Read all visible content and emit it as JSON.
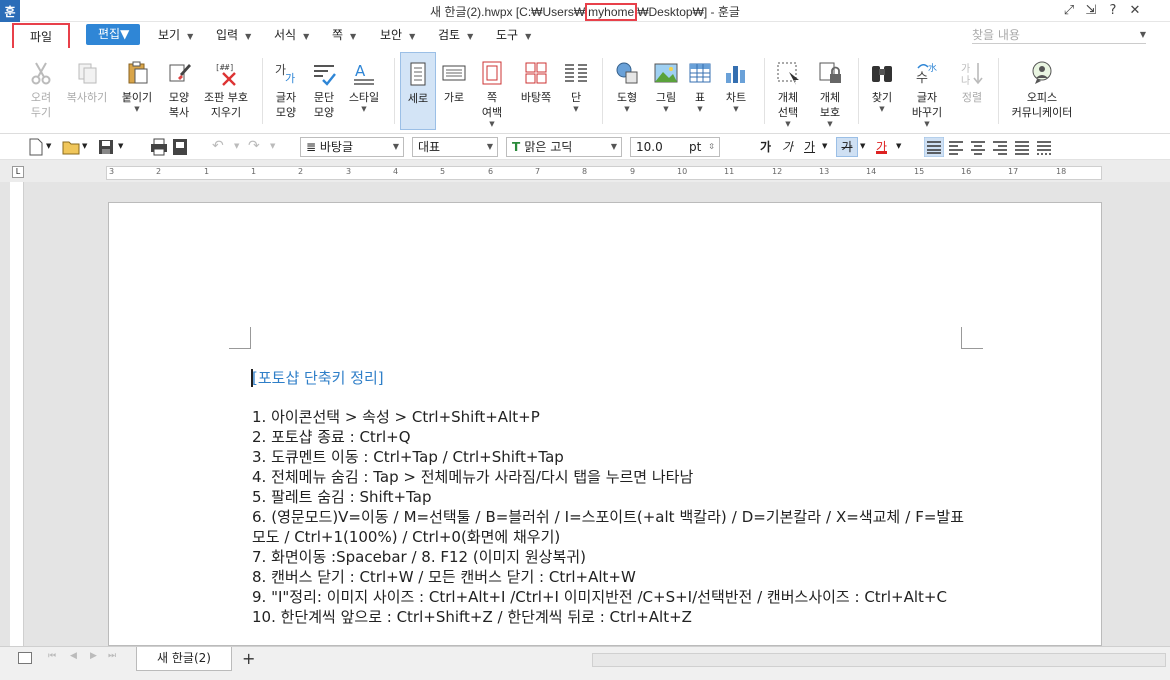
{
  "window": {
    "app_icon": "훈",
    "title_prefix": "새 한글(2).hwpx [C:₩Users₩",
    "title_user": "myhome",
    "title_suffix": "₩Desktop₩] - 훈글",
    "controls": {
      "fullscreen": "⤢",
      "minimize": "⇲",
      "help": "?",
      "close": "✕"
    }
  },
  "menubar": {
    "file": "파일",
    "edit": "편집",
    "items": [
      "보기",
      "입력",
      "서식",
      "쪽",
      "보안",
      "검토",
      "도구"
    ],
    "find_placeholder": "찾을 내용"
  },
  "ribbon": {
    "cut": [
      "오려",
      "두기"
    ],
    "copy": [
      "복사하기"
    ],
    "paste": [
      "붙이기"
    ],
    "format_copy": [
      "모양",
      "복사"
    ],
    "clear_marks": [
      "조판 부호",
      "지우기"
    ],
    "char_shape": [
      "글자",
      "모양"
    ],
    "para_shape": [
      "문단",
      "모양"
    ],
    "style": [
      "스타일"
    ],
    "portrait": [
      "세로"
    ],
    "landscape": [
      "가로"
    ],
    "page_margin": [
      "쪽",
      "여백"
    ],
    "multi_column": [
      "바탕쪽"
    ],
    "columns": [
      "단"
    ],
    "shape": [
      "도형"
    ],
    "image": [
      "그림"
    ],
    "table": [
      "표"
    ],
    "chart": [
      "차트"
    ],
    "object_select": [
      "개체",
      "선택"
    ],
    "object_protect": [
      "개체",
      "보호"
    ],
    "find": [
      "찾기"
    ],
    "replace": [
      "글자",
      "바꾸기"
    ],
    "sort": [
      "정렬"
    ],
    "office_community": [
      "오피스",
      "커뮤니케이터"
    ]
  },
  "toolbar": {
    "style_value": "바탕글",
    "lang_value": "대표",
    "font_value": "맑은 고딕",
    "size_value": "10.0",
    "size_unit": "pt",
    "bold": "가",
    "italic": "가",
    "underline": "가",
    "strike": "가",
    "color": "가"
  },
  "ruler": {
    "ticks": [
      "3",
      "2",
      "1",
      "1",
      "2",
      "3",
      "4",
      "5",
      "6",
      "7",
      "8",
      "9",
      "10",
      "11",
      "12",
      "13",
      "14",
      "15",
      "16",
      "17",
      "18"
    ]
  },
  "document": {
    "heading": "[포토샵 단축키 정리]",
    "lines": [
      "1. 아이콘선택 > 속성 > Ctrl+Shift+Alt+P",
      "2. 포토샵 종료 : Ctrl+Q",
      "3. 도큐멘트 이동 : Ctrl+Tap / Ctrl+Shift+Tap",
      "4. 전체메뉴 숨김 : Tap > 전체메뉴가 사라짐/다시 탭을 누르면 나타남",
      "5. 팔레트 숨김 : Shift+Tap",
      "6. (영문모드)V=이동 / M=선택툴 / B=블러쉬 / I=스포이트(+alt 백칼라) / D=기본칼라 / X=색교체 / F=발표모도 / Ctrl+1(100%) / Ctrl+0(화면에 채우기)",
      "7. 화면이동 :Spacebar / 8. F12 (이미지 원상복귀)",
      "8. 캔버스 닫기 : Ctrl+W / 모든 캔버스 닫기 : Ctrl+Alt+W",
      "9. \"I\"정리: 이미지 사이즈 : Ctrl+Alt+I /Ctrl+I 이미지반전 /C+S+I/선택반전 / 캔버스사이즈 : Ctrl+Alt+C",
      "10. 한단계씩 앞으로 : Ctrl+Shift+Z / 한단계씩 뒤로 : Ctrl+Alt+Z"
    ]
  },
  "statusbar": {
    "tab_label": "새 한글(2)",
    "add_tab": "+"
  },
  "colors": {
    "accent": "#2f86d6",
    "highlight_box": "#e8404a",
    "heading": "#2f7fc8"
  }
}
